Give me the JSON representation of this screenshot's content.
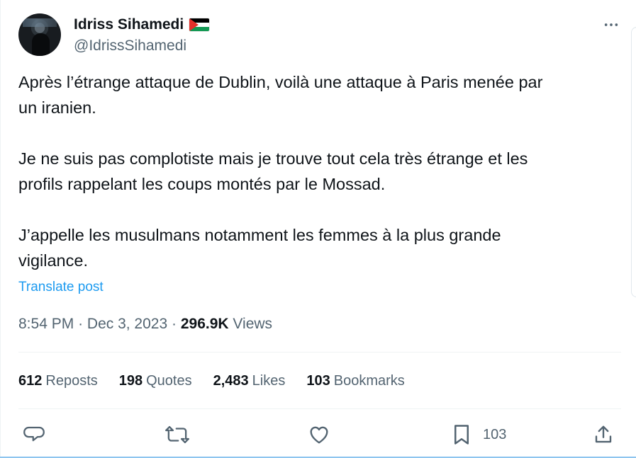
{
  "post": {
    "author": {
      "display_name": "Idriss Sihamedi",
      "handle": "@IdrissSihamedi",
      "avatar_icon": "profile-photo-avatar",
      "flag_icon": "palestine-flag-icon"
    },
    "menu_icon": "more-icon",
    "text": "Après l’étrange attaque de Dublin, voilà une attaque à Paris menée par\nun iranien.\n\nJe ne suis pas complotiste mais je trouve tout cela très étrange et les\nprofils rappelant les coups montés par le Mossad.\n\nJ’appelle les musulmans notamment les femmes à la plus grande\nvigilance.",
    "translate_label": "Translate post",
    "time": "8:54 PM",
    "date": "Dec 3, 2023",
    "separator": "·",
    "views_value": "296.9K",
    "views_label": "Views"
  },
  "stats": {
    "reposts": {
      "value": "612",
      "label": "Reposts"
    },
    "quotes": {
      "value": "198",
      "label": "Quotes"
    },
    "likes": {
      "value": "2,483",
      "label": "Likes"
    },
    "bookmarks": {
      "value": "103",
      "label": "Bookmarks"
    }
  },
  "actions": {
    "reply_icon": "reply-icon",
    "retweet_icon": "retweet-icon",
    "like_icon": "heart-icon",
    "bookmark_icon": "bookmark-icon",
    "bookmark_count": "103",
    "share_icon": "share-icon"
  },
  "colors": {
    "primary_text": "#0f1419",
    "secondary_text": "#536471",
    "link": "#1d9bf0",
    "divider": "#eff3f4"
  }
}
